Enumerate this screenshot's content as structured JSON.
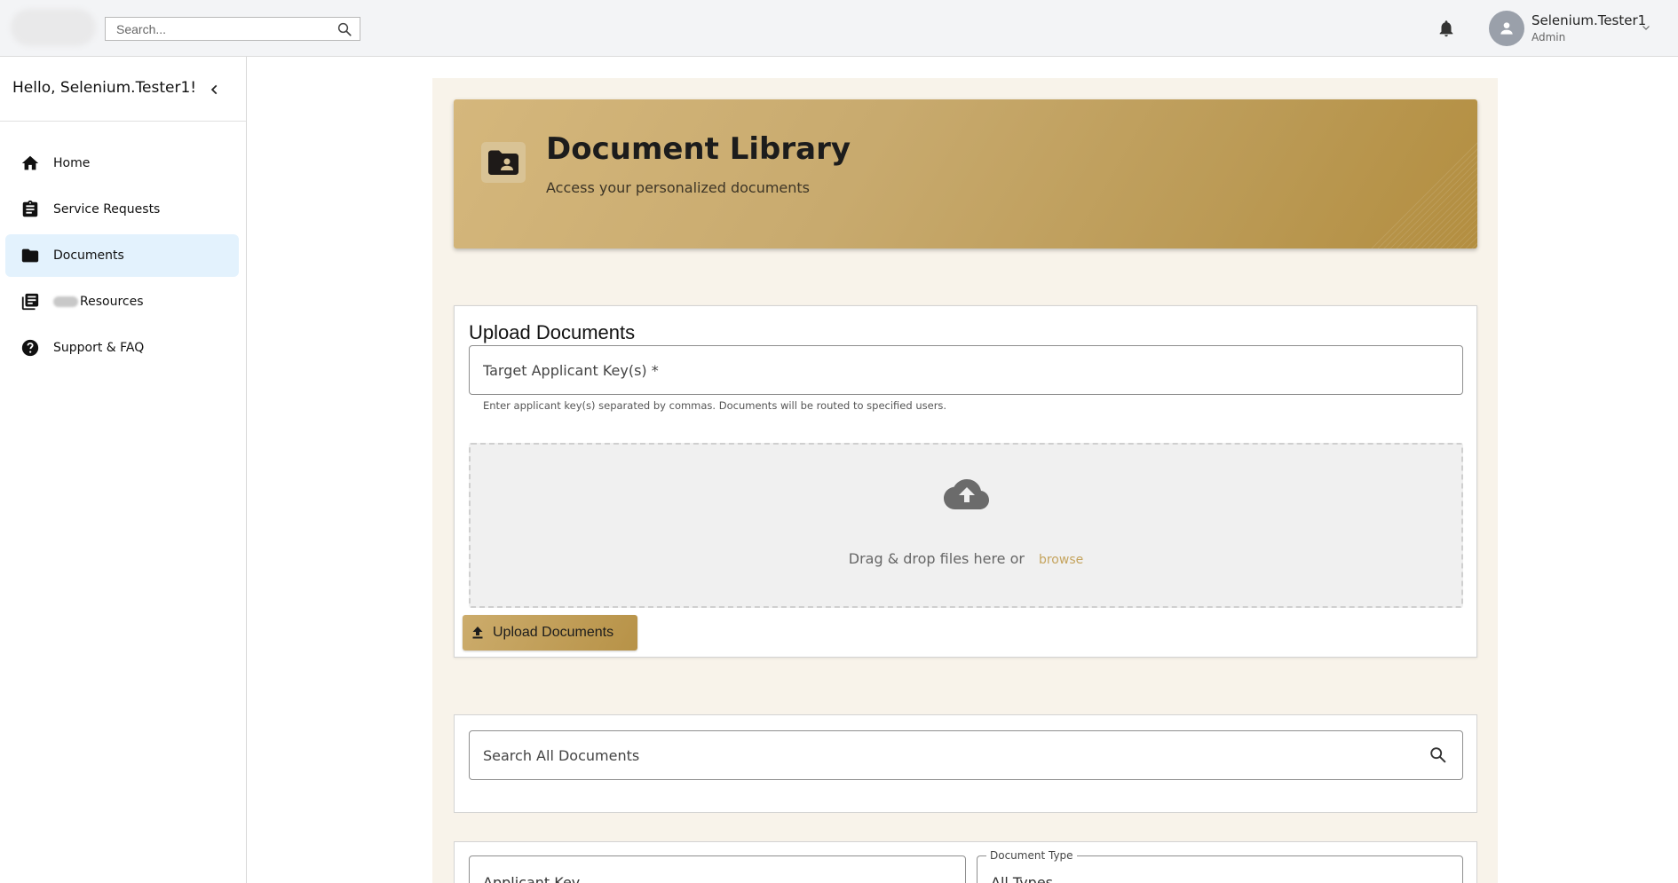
{
  "topbar": {
    "search_placeholder": "Search...",
    "user": {
      "name": "Selenium.Tester1",
      "role": "Admin"
    }
  },
  "sidebar": {
    "greeting": "Hello, Selenium.Tester1!",
    "items": [
      {
        "label": "Home",
        "icon": "home-icon",
        "active": false
      },
      {
        "label": "Service Requests",
        "icon": "clipboard-icon",
        "active": false
      },
      {
        "label": "Documents",
        "icon": "folder-icon",
        "active": true
      },
      {
        "label": "Resources",
        "icon": "library-icon",
        "active": false,
        "redacted_prefix": true
      },
      {
        "label": "Support & FAQ",
        "icon": "help-circle-icon",
        "active": false
      }
    ]
  },
  "hero": {
    "title": "Document Library",
    "subtitle": "Access your personalized documents"
  },
  "upload": {
    "title": "Upload Documents",
    "key_field_placeholder": "Target Applicant Key(s) *",
    "key_hint": "Enter applicant key(s) separated by commas. Documents will be routed to specified users.",
    "drop_text": "Drag & drop files here or",
    "browse_label": "browse",
    "button_label": "Upload Documents"
  },
  "search": {
    "placeholder": "Search All Documents"
  },
  "filters": {
    "applicant_key_label": "Applicant Key",
    "document_type_legend": "Document Type",
    "document_type_value": "All Types"
  },
  "colors": {
    "accent_gold": "#c5a45e",
    "nav_active_bg": "#e3f2fd",
    "panel_bg": "#f8f3ea"
  }
}
